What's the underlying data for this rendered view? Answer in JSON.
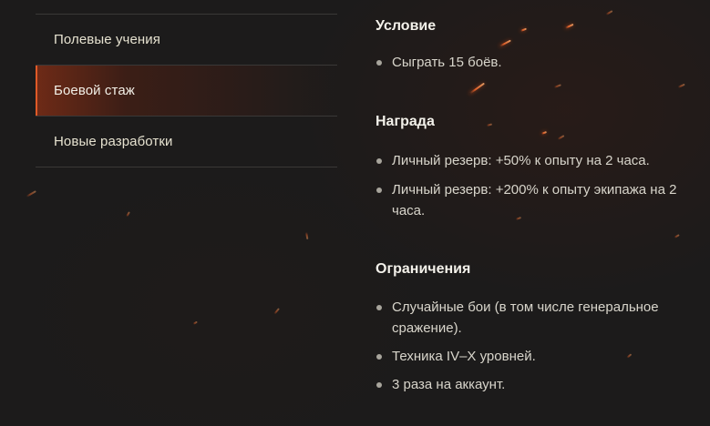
{
  "sidebar": {
    "items": [
      {
        "label": "Полевые учения",
        "active": false
      },
      {
        "label": "Боевой стаж",
        "active": true
      },
      {
        "label": "Новые разработки",
        "active": false
      }
    ]
  },
  "sections": {
    "condition": {
      "heading": "Условие",
      "items": [
        "Сыграть 15 боёв."
      ]
    },
    "reward": {
      "heading": "Награда",
      "items": [
        "Личный резерв: +50% к опыту на 2 часа.",
        "Личный резерв: +200% к опыту экипажа на 2 часа."
      ]
    },
    "limits": {
      "heading": "Ограничения",
      "items": [
        "Случайные бои (в том числе генеральное сражение).",
        "Техника IV–X уровней.",
        "3 раза на аккаунт."
      ]
    }
  },
  "colors": {
    "background": "#1c1b1b",
    "accent": "#e05a27",
    "active_item_bg": "#7d2d16",
    "heading": "#f3f1ea",
    "text": "#d8d5cb"
  }
}
